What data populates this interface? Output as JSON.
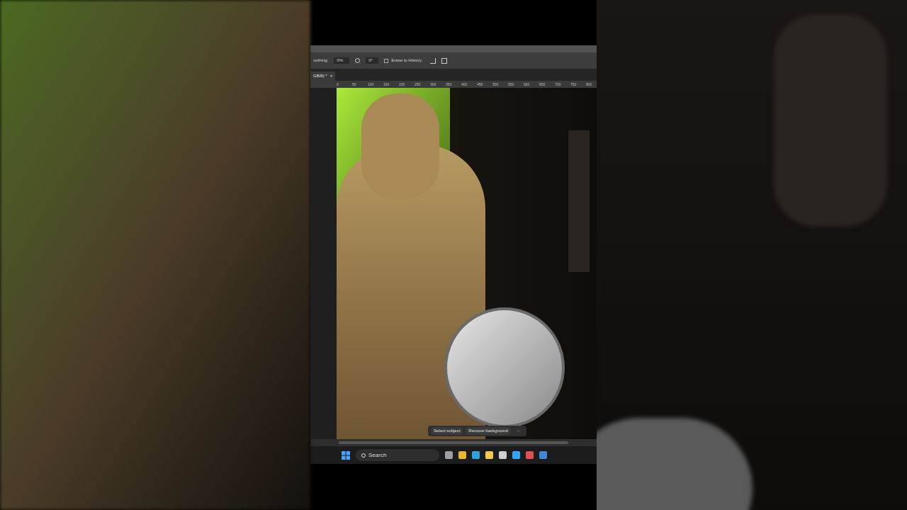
{
  "video": {
    "kind": "short",
    "side_panels": "blurred"
  },
  "toolbar": {
    "smoothing_label": "oothing:",
    "smoothing_value": "0%",
    "angle_value": "0°",
    "erase_to_history": {
      "label": "Erase to History",
      "checked": false
    }
  },
  "document_tab": {
    "label": "GB/8) *",
    "close": "×",
    "selected": true
  },
  "ruler": {
    "ticks": [
      "0",
      "50",
      "100",
      "150",
      "200",
      "250",
      "300",
      "350",
      "400",
      "450",
      "500",
      "550",
      "600",
      "650",
      "700",
      "750",
      "800"
    ]
  },
  "contextual_task_bar": {
    "buttons": [
      "Select subject",
      "Remove background"
    ],
    "more": "···"
  },
  "taskbar": {
    "search": {
      "placeholder": "Search"
    },
    "apps": [
      {
        "name": "task-view",
        "color": "#9aa0a6"
      },
      {
        "name": "chrome",
        "color": "#e8b72f"
      },
      {
        "name": "edge",
        "color": "#2fa3e0"
      },
      {
        "name": "explorer",
        "color": "#f2c94c"
      },
      {
        "name": "store",
        "color": "#d0d0d0"
      },
      {
        "name": "photoshop",
        "color": "#31a8ff"
      },
      {
        "name": "app",
        "color": "#e05050"
      },
      {
        "name": "app2",
        "color": "#3f88d8"
      }
    ]
  }
}
